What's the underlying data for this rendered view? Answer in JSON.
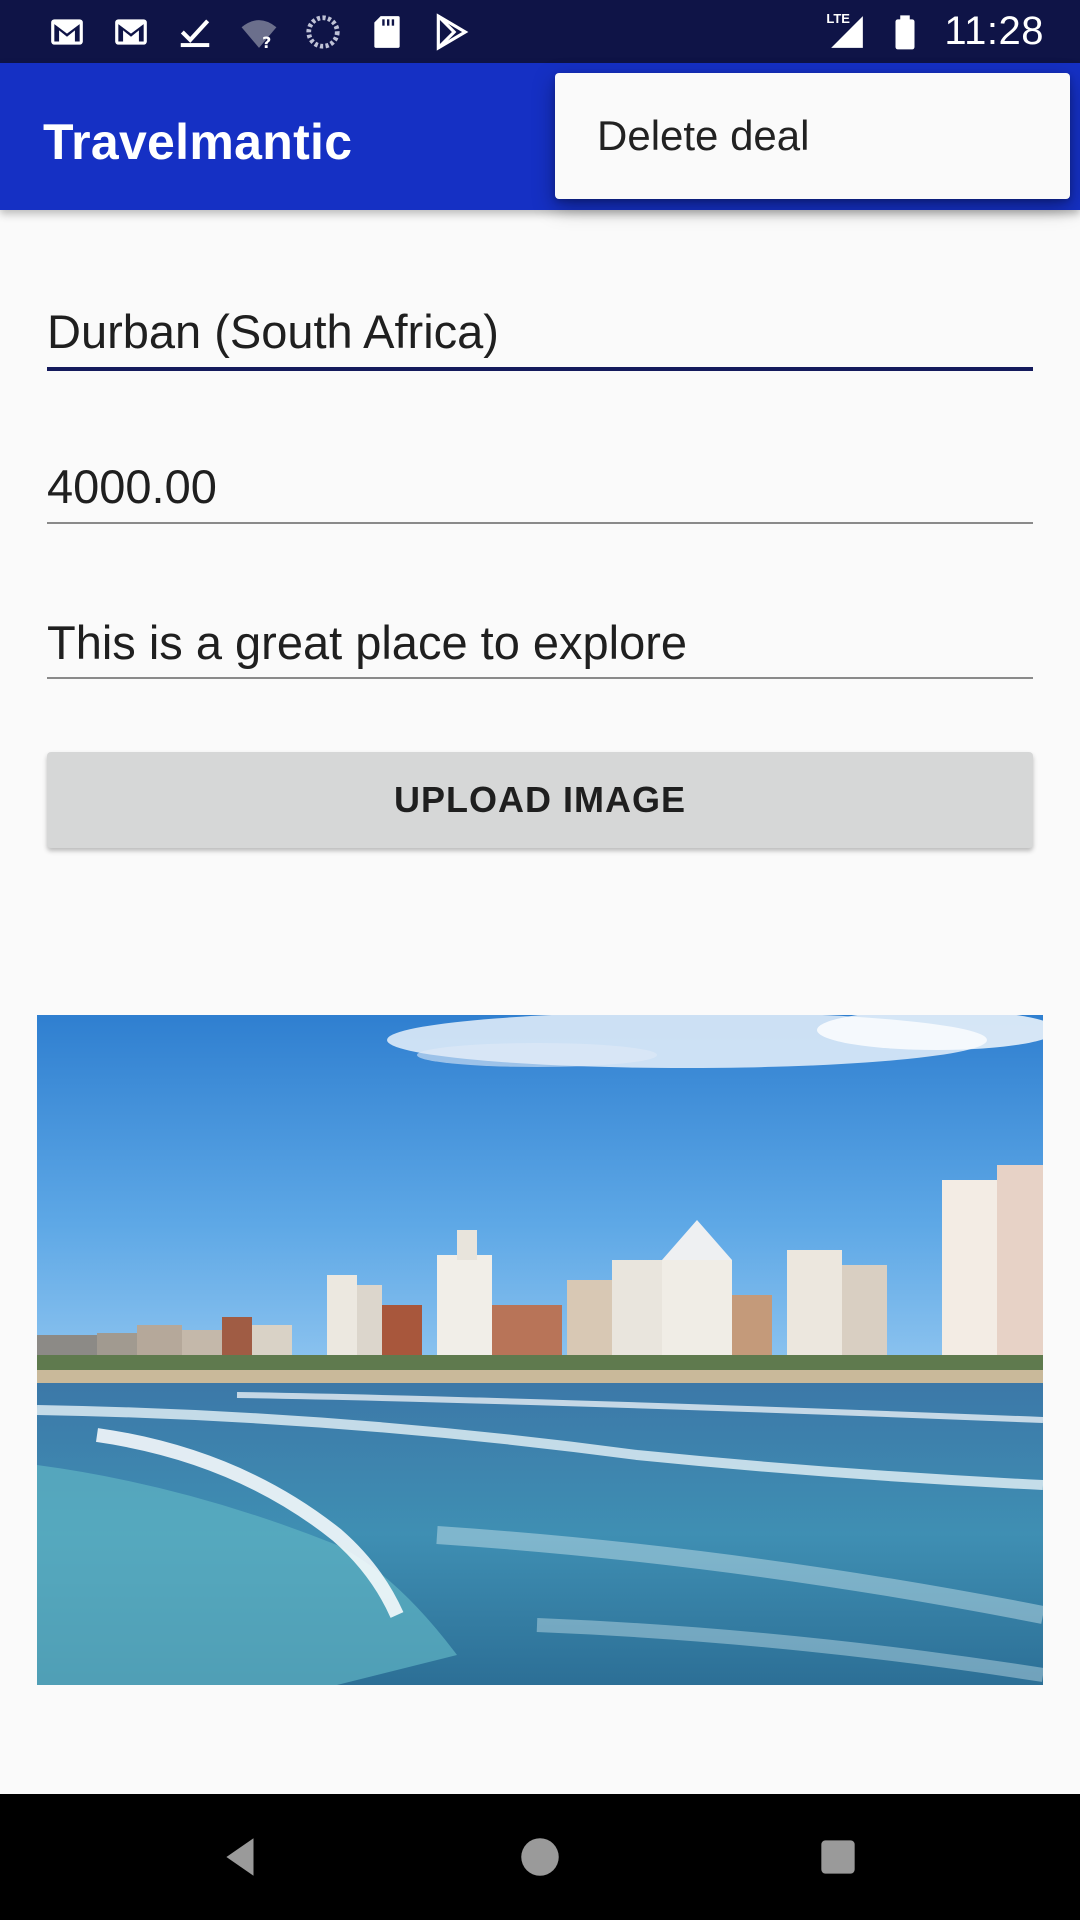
{
  "status_bar": {
    "time": "11:28",
    "network_label": "LTE",
    "left_icons": [
      "gmail-icon",
      "gmail-icon",
      "download-done-icon",
      "wifi-unknown-icon",
      "loading-circle-icon",
      "sd-card-icon",
      "play-store-icon"
    ],
    "right_icons": [
      "signal-icon",
      "battery-icon"
    ]
  },
  "app_bar": {
    "title": "Travelmantic"
  },
  "overflow_menu": {
    "items": [
      {
        "label": "Delete deal"
      }
    ]
  },
  "form": {
    "title_value": "Durban (South Africa)",
    "price_value": "4000.00",
    "description_value": "This is a great place to explore",
    "upload_button_label": "UPLOAD IMAGE"
  },
  "image": {
    "subject": "beach-city-skyline"
  },
  "nav_bar": {
    "buttons": [
      "back-icon",
      "home-icon",
      "recents-icon"
    ]
  },
  "colors": {
    "status_bar": "#0f1447",
    "app_bar": "#1530c4",
    "background": "#fafafa",
    "button": "#d6d7d7",
    "active_underline": "#141a5c"
  }
}
